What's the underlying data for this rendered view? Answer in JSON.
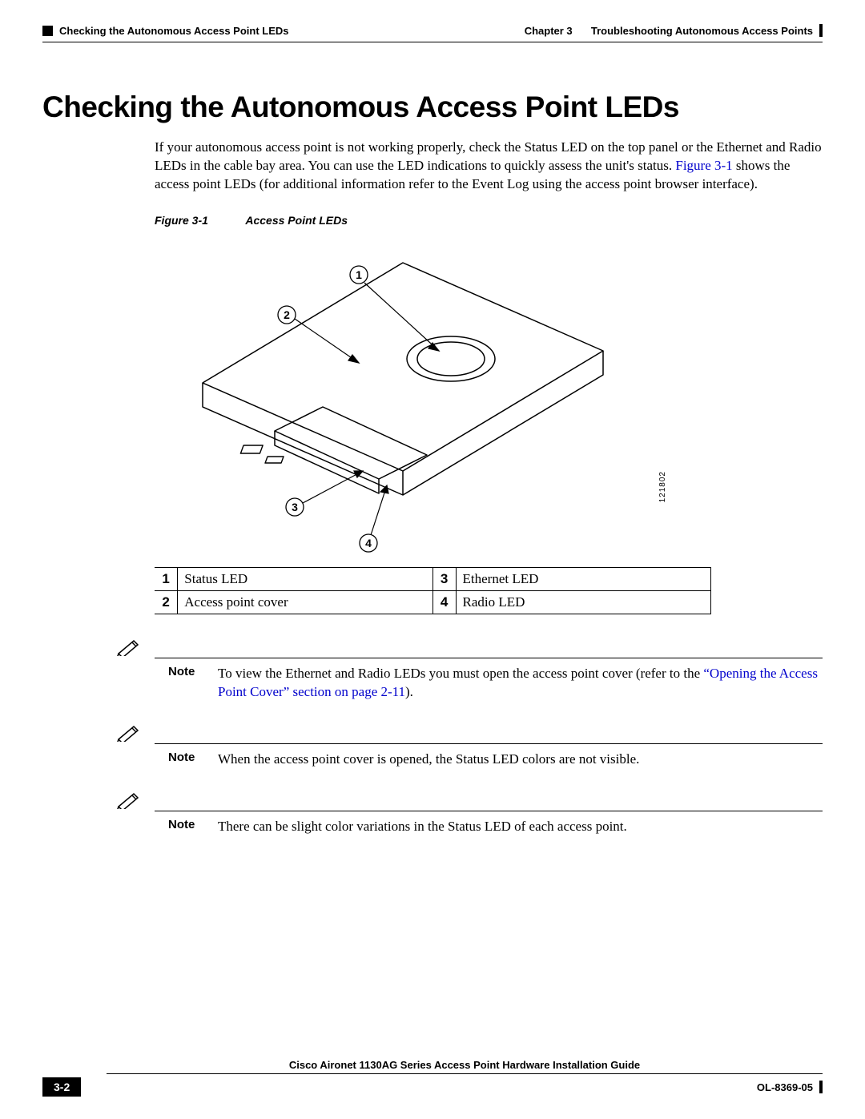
{
  "header": {
    "section_left": "Checking the Autonomous Access Point LEDs",
    "chapter_label": "Chapter 3",
    "chapter_title": "Troubleshooting Autonomous Access Points"
  },
  "heading": "Checking the Autonomous Access Point LEDs",
  "intro": {
    "text_before": "If your autonomous access point is not working properly, check the Status LED on the top panel or the Ethernet and Radio LEDs in the cable bay area. You can use the LED indications to quickly assess the unit's status. ",
    "link": "Figure 3-1",
    "text_after": " shows the access point LEDs (for additional information refer to the Event Log using the access point browser interface)."
  },
  "figure": {
    "label": "Figure 3-1",
    "title": "Access Point LEDs",
    "image_id": "121802",
    "callouts": [
      "1",
      "2",
      "3",
      "4"
    ]
  },
  "legend": [
    {
      "num": "1",
      "desc": "Status LED"
    },
    {
      "num": "3",
      "desc": "Ethernet LED"
    },
    {
      "num": "2",
      "desc": "Access point cover"
    },
    {
      "num": "4",
      "desc": "Radio LED"
    }
  ],
  "notes": [
    {
      "label": "Note",
      "text_before": "To view the Ethernet and Radio LEDs you must open the access point cover (refer to the ",
      "link": "“Opening the Access Point Cover” section on page 2-11",
      "text_after": ")."
    },
    {
      "label": "Note",
      "text_before": "When the access point cover is opened, the Status LED colors are not visible.",
      "link": "",
      "text_after": ""
    },
    {
      "label": "Note",
      "text_before": "There can be slight color variations in the Status LED of each access point.",
      "link": "",
      "text_after": ""
    }
  ],
  "footer": {
    "guide_title": "Cisco Aironet 1130AG Series Access Point Hardware Installation Guide",
    "page": "3-2",
    "doc_id": "OL-8369-05"
  }
}
